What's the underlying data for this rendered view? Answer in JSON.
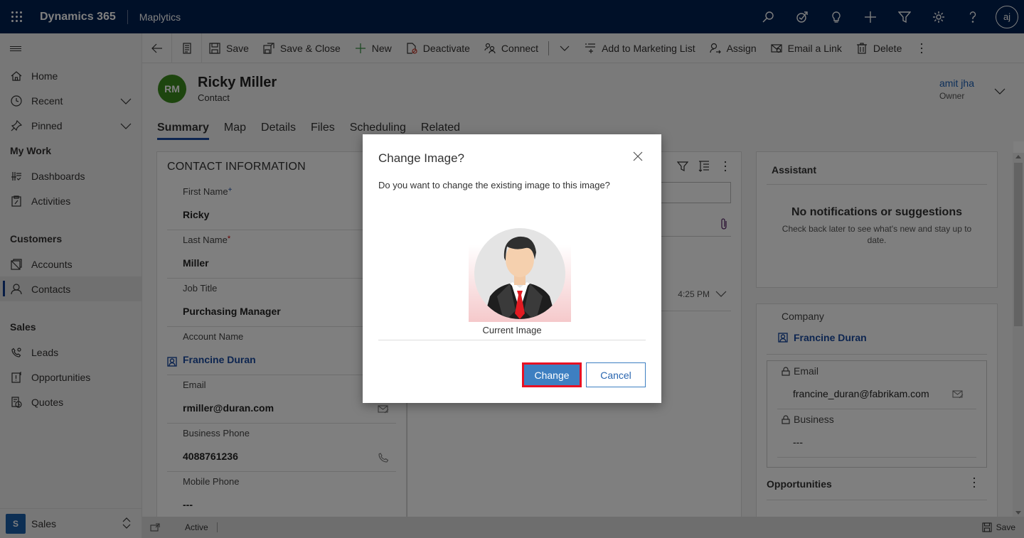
{
  "topbar": {
    "brand": "Dynamics 365",
    "app_name": "Maplytics",
    "user_initials": "aj",
    "icons": [
      "search-icon",
      "task-flow-icon",
      "lightbulb-icon",
      "plus-icon",
      "filter-icon",
      "gear-icon",
      "help-icon"
    ]
  },
  "sidebar": {
    "top_items": [
      {
        "label": "Home",
        "icon": "home-icon"
      },
      {
        "label": "Recent",
        "icon": "clock-icon",
        "expandable": true
      },
      {
        "label": "Pinned",
        "icon": "pin-icon",
        "expandable": true
      }
    ],
    "sections": [
      {
        "title": "My Work",
        "items": [
          {
            "label": "Dashboards",
            "icon": "dashboard-icon"
          },
          {
            "label": "Activities",
            "icon": "clipboard-icon"
          }
        ]
      },
      {
        "title": "Customers",
        "items": [
          {
            "label": "Accounts",
            "icon": "accounts-icon"
          },
          {
            "label": "Contacts",
            "icon": "person-icon",
            "active": true
          }
        ]
      },
      {
        "title": "Sales",
        "items": [
          {
            "label": "Leads",
            "icon": "phone-gear-icon"
          },
          {
            "label": "Opportunities",
            "icon": "opportunity-icon"
          },
          {
            "label": "Quotes",
            "icon": "quote-icon"
          }
        ]
      }
    ],
    "area": {
      "badge": "S",
      "label": "Sales"
    }
  },
  "commandbar": {
    "items": [
      "Save",
      "Save & Close",
      "New",
      "Deactivate",
      "Connect",
      "Add to Marketing List",
      "Assign",
      "Email a Link",
      "Delete"
    ]
  },
  "record": {
    "initials": "RM",
    "name": "Ricky Miller",
    "entity": "Contact",
    "owner_name": "amit jha",
    "owner_label": "Owner",
    "avatar_color": "#3b8a1c"
  },
  "tabs": [
    {
      "label": "Summary",
      "active": true
    },
    {
      "label": "Map"
    },
    {
      "label": "Details"
    },
    {
      "label": "Files"
    },
    {
      "label": "Scheduling"
    },
    {
      "label": "Related"
    }
  ],
  "contact_info": {
    "title": "CONTACT INFORMATION",
    "fields": [
      {
        "label": "First Name",
        "value": "Ricky",
        "required": "recommended"
      },
      {
        "label": "Last Name",
        "value": "Miller",
        "required": "required"
      },
      {
        "label": "Job Title",
        "value": "Purchasing Manager"
      },
      {
        "label": "Account Name",
        "value": "Francine Duran",
        "link": true
      },
      {
        "label": "Email",
        "value": "rmiller@duran.com",
        "trail_icon": "email-icon"
      },
      {
        "label": "Business Phone",
        "value": "4088761236",
        "trail_icon": "phone-icon"
      },
      {
        "label": "Mobile Phone",
        "value": "---"
      }
    ]
  },
  "timeline": {
    "time": "4:25 PM"
  },
  "assistant": {
    "title": "Assistant",
    "empty_title": "No notifications or suggestions",
    "empty_sub": "Check back later to see what's new and stay up to date."
  },
  "company": {
    "label": "Company",
    "value": "Francine Duran",
    "email_label": "Email",
    "email_value": "francine_duran@fabrikam.com",
    "business_label": "Business",
    "business_value": "---",
    "opportunities_title": "Opportunities"
  },
  "statusbar": {
    "status": "Active",
    "save_label": "Save"
  },
  "dialog": {
    "title": "Change Image?",
    "message": "Do you want to change the existing image to this image?",
    "image_caption": "Current Image",
    "confirm_label": "Change",
    "cancel_label": "Cancel",
    "highlight_color": "#e81123"
  }
}
